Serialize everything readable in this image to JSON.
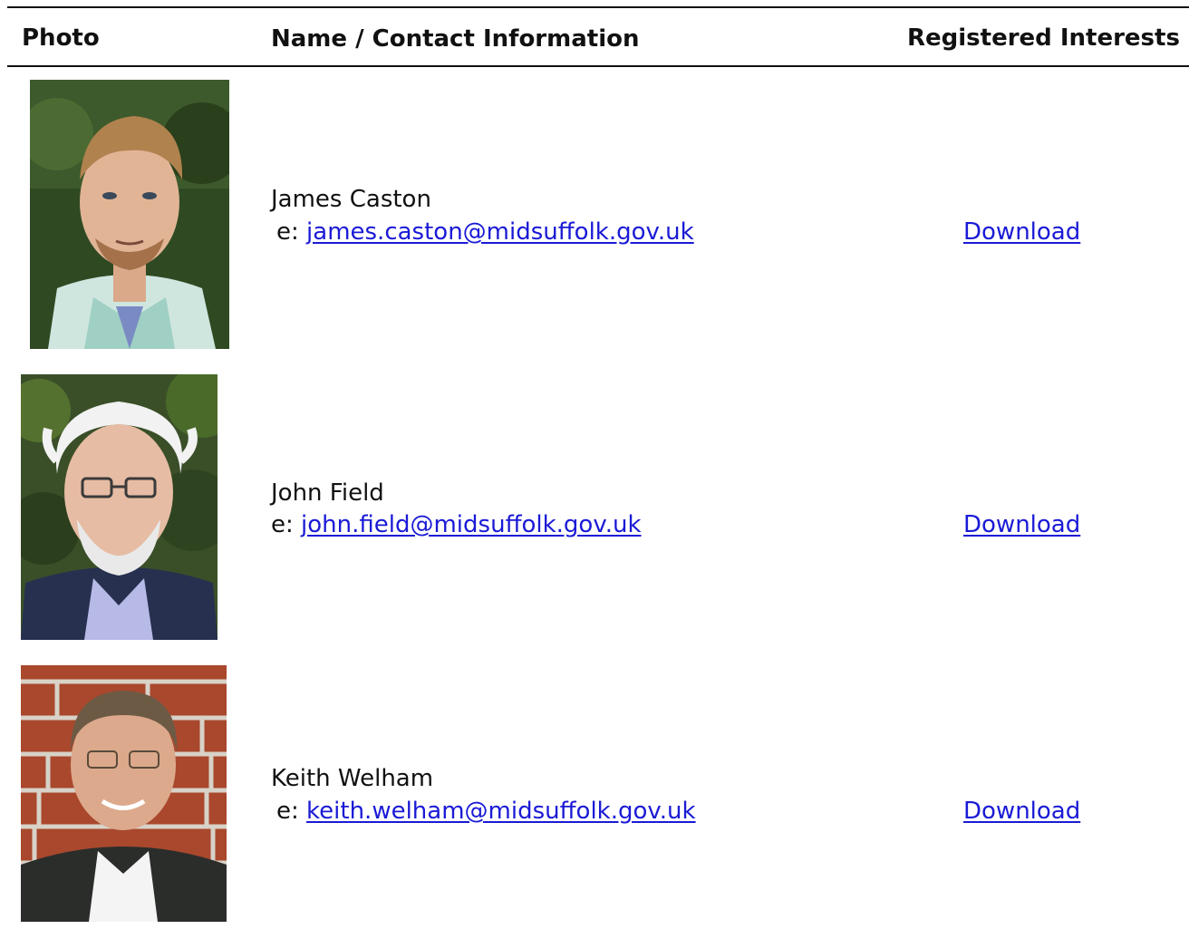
{
  "header": {
    "photo": "Photo",
    "name_contact": "Name / Contact Information",
    "registered_interests": "Registered Interests"
  },
  "members": [
    {
      "name": "James Caston",
      "email_prefix": "e: ",
      "email": "james.caston@midsuffolk.gov.uk",
      "interests_link": "Download"
    },
    {
      "name": "John Field",
      "email_prefix": "e: ",
      "email": "john.field@midsuffolk.gov.uk",
      "interests_link": "Download"
    },
    {
      "name": "Keith Welham",
      "email_prefix": "e: ",
      "email": "keith.welham@midsuffolk.gov.uk",
      "interests_link": "Download"
    }
  ],
  "colors": {
    "link": "#1a1ad6",
    "rule": "#111111"
  }
}
